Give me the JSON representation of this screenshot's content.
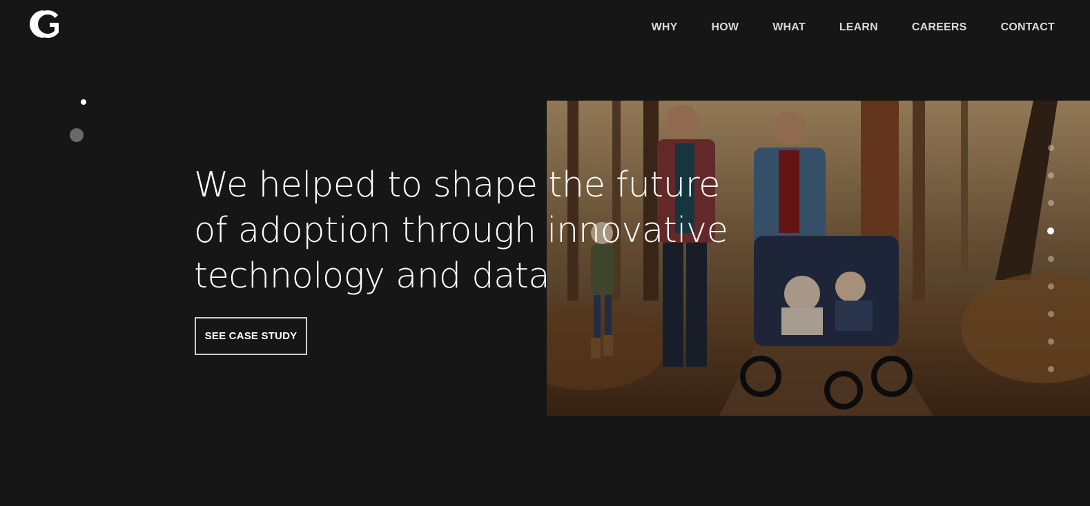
{
  "brand": {
    "logo_icon": "cg-monogram-logo"
  },
  "nav": {
    "items": [
      {
        "label": "WHY"
      },
      {
        "label": "HOW"
      },
      {
        "label": "WHAT"
      },
      {
        "label": "LEARN"
      },
      {
        "label": "CAREERS"
      },
      {
        "label": "CONTACT"
      }
    ]
  },
  "hero": {
    "headline_lines": [
      "We helped to shape the future",
      "of adoption through innovative",
      "technology and data"
    ],
    "cta_label": "SEE CASE STUDY",
    "image_subject": "family-walking-in-forest-photo"
  },
  "pagination": {
    "total": 9,
    "active_index": 3
  },
  "colors": {
    "background": "#161616",
    "text": "#ffffff",
    "nav_text": "#d9d9d9",
    "dot_inactive": "#6a6a6a"
  }
}
